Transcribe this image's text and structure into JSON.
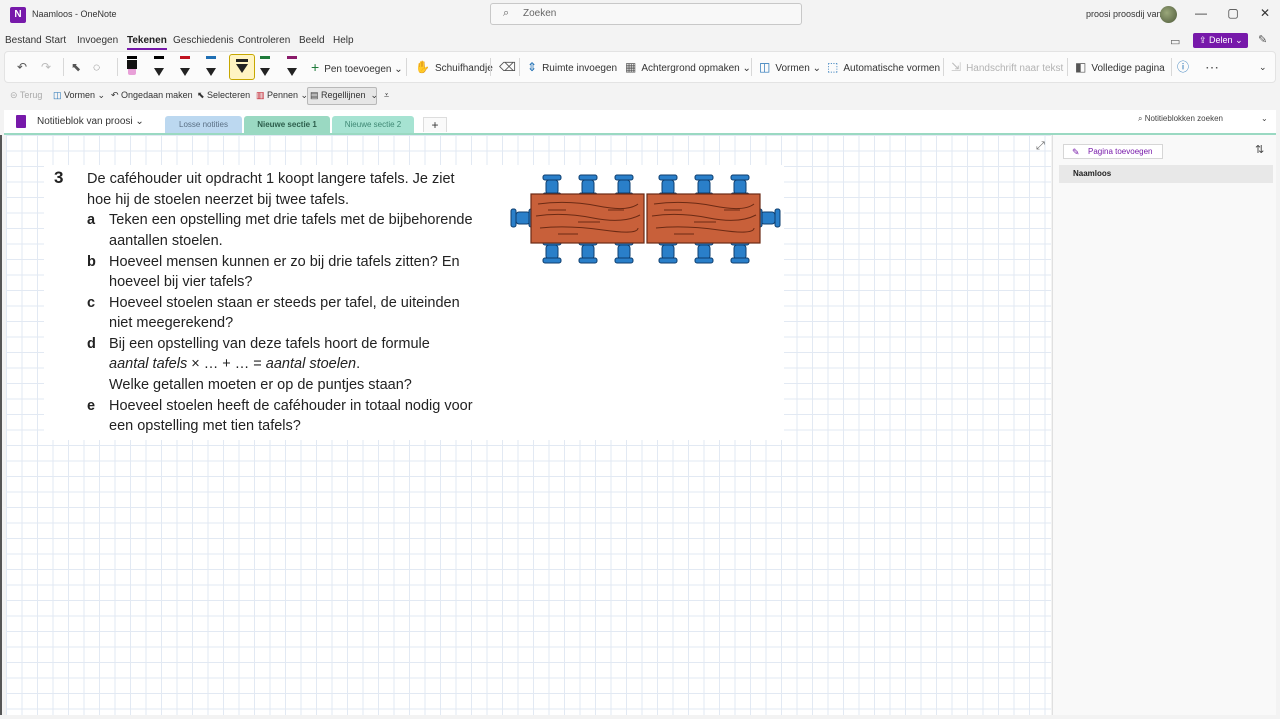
{
  "window": {
    "app_icon_letter": "N",
    "title": "Naamloos - OneNote",
    "search_placeholder": "Zoeken",
    "user": "proosi proosdij van",
    "minimize": "—",
    "maximize": "▢",
    "close": "✕"
  },
  "menu": {
    "items": [
      "Bestand",
      "Start",
      "Invoegen",
      "Tekenen",
      "Geschiedenis",
      "Controleren",
      "Beeld",
      "Help"
    ],
    "active": "Tekenen",
    "share": "Delen"
  },
  "ribbon": {
    "pen_add": "Pen toevoegen",
    "hand": "Schuifhandje",
    "space": "Ruimte invoegen",
    "background": "Achtergrond opmaken",
    "shapes": "Vormen",
    "auto_shapes": "Automatische vormen",
    "ink_to_text": "Handschrift naar tekst",
    "full_page": "Volledige pagina",
    "pen_colors": [
      "#e8a0d8",
      "#222222",
      "#c0121f",
      "#1f6fb4",
      "#222222",
      "#1e7a3a",
      "#8a1a6a"
    ]
  },
  "toolbar2": {
    "back": "Terug",
    "shapes": "Vormen",
    "undo": "Ongedaan maken",
    "select": "Selecteren",
    "pens": "Pennen",
    "rules": "Regellijnen"
  },
  "sections": {
    "notebook": "Notitieblok van proosi",
    "tabs": [
      "Losse notities",
      "Nieuwe sectie 1",
      "Nieuwe sectie 2"
    ],
    "add": "+",
    "search_notebooks": "Notitieblokken zoeken"
  },
  "content": {
    "number": "3",
    "intro_line1": "De caféhouder uit opdracht 1 koopt langere tafels. Je ziet",
    "intro_line2": "hoe hij de stoelen neerzet bij twee tafels.",
    "a_letter": "a",
    "a_line1": "Teken een opstelling met drie tafels met de bijbehorende",
    "a_line2": "aantallen stoelen.",
    "b_letter": "b",
    "b_line1": "Hoeveel mensen kunnen er zo bij drie tafels zitten? En",
    "b_line2": "hoeveel bij vier tafels?",
    "c_letter": "c",
    "c_line1": "Hoeveel stoelen staan er steeds per tafel, de uiteinden",
    "c_line2": "niet meegerekend?",
    "d_letter": "d",
    "d_line1": "Bij een opstelling van deze tafels hoort de formule",
    "d_formula_a": "aantal tafels",
    "d_formula_mid": " × … + … = ",
    "d_formula_b": "aantal stoelen",
    "d_formula_end": ".",
    "d_line3": "Welke getallen moeten er op de puntjes staan?",
    "e_letter": "e",
    "e_line1": "Hoeveel stoelen heeft de caféhouder in totaal nodig voor",
    "e_line2": "een opstelling met tien tafels?"
  },
  "pages": {
    "add_page": "Pagina toevoegen",
    "items": [
      "Naamloos"
    ]
  }
}
